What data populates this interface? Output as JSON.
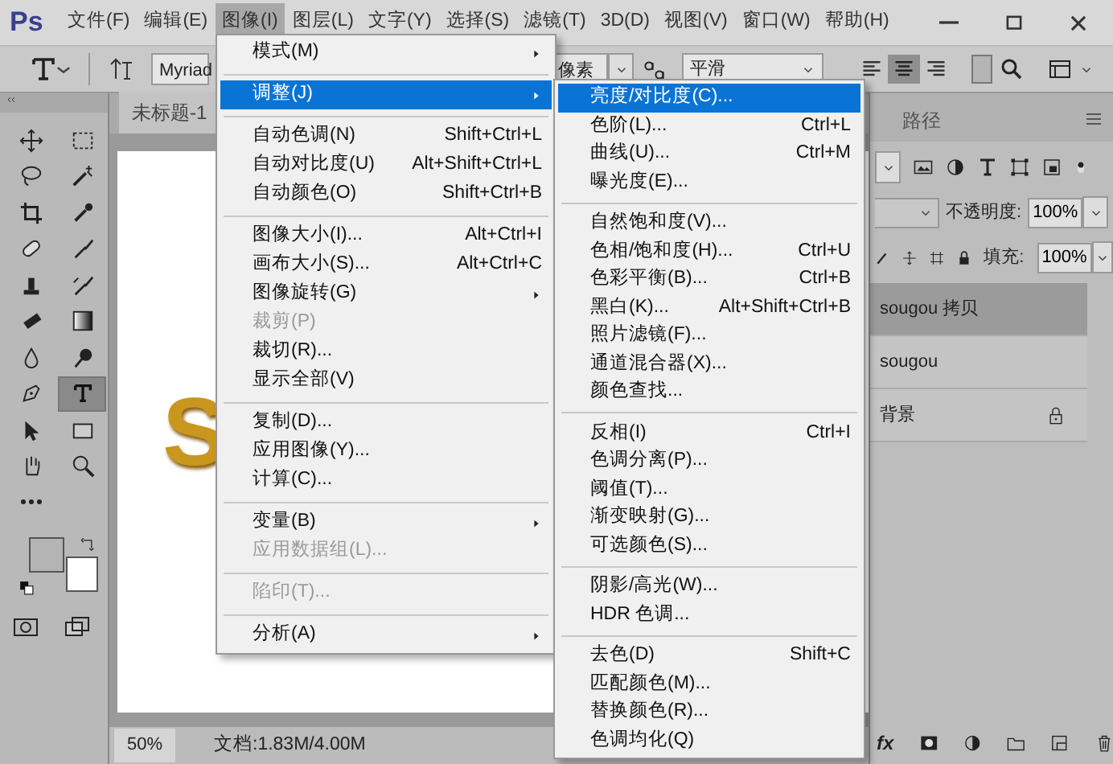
{
  "app": {
    "logo": "Ps"
  },
  "menubar": [
    {
      "label": "文件(F)",
      "selected": false
    },
    {
      "label": "编辑(E)",
      "selected": false
    },
    {
      "label": "图像(I)",
      "selected": true
    },
    {
      "label": "图层(L)",
      "selected": false
    },
    {
      "label": "文字(Y)",
      "selected": false
    },
    {
      "label": "选择(S)",
      "selected": false
    },
    {
      "label": "滤镜(T)",
      "selected": false
    },
    {
      "label": "3D(D)",
      "selected": false
    },
    {
      "label": "视图(V)",
      "selected": false
    },
    {
      "label": "窗口(W)",
      "selected": false
    },
    {
      "label": "帮助(H)",
      "selected": false
    }
  ],
  "options_bar": {
    "font": "Myriad",
    "units": "像素",
    "antialias": "平滑",
    "align": [
      {
        "selected": false
      },
      {
        "selected": true
      },
      {
        "selected": false
      }
    ]
  },
  "tools": [
    {
      "selected": false
    },
    {
      "selected": false
    },
    {
      "selected": false
    },
    {
      "selected": false
    },
    {
      "selected": false
    },
    {
      "selected": false
    },
    {
      "selected": false
    },
    {
      "selected": false
    },
    {
      "selected": false
    },
    {
      "selected": false
    },
    {
      "selected": false
    },
    {
      "selected": false
    },
    {
      "selected": false
    },
    {
      "selected": false
    },
    {
      "selected": false
    },
    {
      "selected": true
    },
    {
      "selected": false
    },
    {
      "selected": false
    },
    {
      "selected": false
    },
    {
      "selected": false
    },
    {
      "selected": false
    }
  ],
  "document": {
    "tab": "未标题-1",
    "canvas_text": "S",
    "zoom": "50%",
    "info": "文档:1.83M/4.00M"
  },
  "image_menu": [
    {
      "kind": "item",
      "label": "模式(M)",
      "has_submenu": true,
      "selected": false,
      "disabled": false
    },
    {
      "kind": "separator"
    },
    {
      "kind": "item",
      "label": "调整(J)",
      "has_submenu": true,
      "selected": true,
      "disabled": false
    },
    {
      "kind": "separator"
    },
    {
      "kind": "item",
      "label": "自动色调(N)",
      "shortcut": "Shift+Ctrl+L",
      "has_submenu": false,
      "selected": false,
      "disabled": false
    },
    {
      "kind": "item",
      "label": "自动对比度(U)",
      "shortcut": "Alt+Shift+Ctrl+L",
      "has_submenu": false,
      "selected": false,
      "disabled": false
    },
    {
      "kind": "item",
      "label": "自动颜色(O)",
      "shortcut": "Shift+Ctrl+B",
      "has_submenu": false,
      "selected": false,
      "disabled": false
    },
    {
      "kind": "separator"
    },
    {
      "kind": "item",
      "label": "图像大小(I)...",
      "shortcut": "Alt+Ctrl+I",
      "has_submenu": false,
      "selected": false,
      "disabled": false
    },
    {
      "kind": "item",
      "label": "画布大小(S)...",
      "shortcut": "Alt+Ctrl+C",
      "has_submenu": false,
      "selected": false,
      "disabled": false
    },
    {
      "kind": "item",
      "label": "图像旋转(G)",
      "has_submenu": true,
      "selected": false,
      "disabled": false
    },
    {
      "kind": "item",
      "label": "裁剪(P)",
      "has_submenu": false,
      "selected": false,
      "disabled": true
    },
    {
      "kind": "item",
      "label": "裁切(R)...",
      "has_submenu": false,
      "selected": false,
      "disabled": false
    },
    {
      "kind": "item",
      "label": "显示全部(V)",
      "has_submenu": false,
      "selected": false,
      "disabled": false
    },
    {
      "kind": "separator"
    },
    {
      "kind": "item",
      "label": "复制(D)...",
      "has_submenu": false,
      "selected": false,
      "disabled": false
    },
    {
      "kind": "item",
      "label": "应用图像(Y)...",
      "has_submenu": false,
      "selected": false,
      "disabled": false
    },
    {
      "kind": "item",
      "label": "计算(C)...",
      "has_submenu": false,
      "selected": false,
      "disabled": false
    },
    {
      "kind": "separator"
    },
    {
      "kind": "item",
      "label": "变量(B)",
      "has_submenu": true,
      "selected": false,
      "disabled": false
    },
    {
      "kind": "item",
      "label": "应用数据组(L)...",
      "has_submenu": false,
      "selected": false,
      "disabled": true
    },
    {
      "kind": "separator"
    },
    {
      "kind": "item",
      "label": "陷印(T)...",
      "has_submenu": false,
      "selected": false,
      "disabled": true
    },
    {
      "kind": "separator"
    },
    {
      "kind": "item",
      "label": "分析(A)",
      "has_submenu": true,
      "selected": false,
      "disabled": false
    }
  ],
  "adjust_submenu": [
    {
      "kind": "item",
      "label": "亮度/对比度(C)...",
      "selected": true
    },
    {
      "kind": "item",
      "label": "色阶(L)...",
      "shortcut": "Ctrl+L",
      "selected": false
    },
    {
      "kind": "item",
      "label": "曲线(U)...",
      "shortcut": "Ctrl+M",
      "selected": false
    },
    {
      "kind": "item",
      "label": "曝光度(E)...",
      "selected": false
    },
    {
      "kind": "separator"
    },
    {
      "kind": "item",
      "label": "自然饱和度(V)...",
      "selected": false
    },
    {
      "kind": "item",
      "label": "色相/饱和度(H)...",
      "shortcut": "Ctrl+U",
      "selected": false
    },
    {
      "kind": "item",
      "label": "色彩平衡(B)...",
      "shortcut": "Ctrl+B",
      "selected": false
    },
    {
      "kind": "item",
      "label": "黑白(K)...",
      "shortcut": "Alt+Shift+Ctrl+B",
      "selected": false
    },
    {
      "kind": "item",
      "label": "照片滤镜(F)...",
      "selected": false
    },
    {
      "kind": "item",
      "label": "通道混合器(X)...",
      "selected": false
    },
    {
      "kind": "item",
      "label": "颜色查找...",
      "selected": false
    },
    {
      "kind": "separator"
    },
    {
      "kind": "item",
      "label": "反相(I)",
      "shortcut": "Ctrl+I",
      "selected": false
    },
    {
      "kind": "item",
      "label": "色调分离(P)...",
      "selected": false
    },
    {
      "kind": "item",
      "label": "阈值(T)...",
      "selected": false
    },
    {
      "kind": "item",
      "label": "渐变映射(G)...",
      "selected": false
    },
    {
      "kind": "item",
      "label": "可选颜色(S)...",
      "selected": false
    },
    {
      "kind": "separator"
    },
    {
      "kind": "item",
      "label": "阴影/高光(W)...",
      "selected": false
    },
    {
      "kind": "item",
      "label": "HDR 色调...",
      "selected": false
    },
    {
      "kind": "separator"
    },
    {
      "kind": "item",
      "label": "去色(D)",
      "shortcut": "Shift+C",
      "selected": false
    },
    {
      "kind": "item",
      "label": "匹配颜色(M)...",
      "selected": false
    },
    {
      "kind": "item",
      "label": "替换颜色(R)...",
      "selected": false
    },
    {
      "kind": "item",
      "label": "色调均化(Q)",
      "selected": false
    }
  ],
  "layers_panel": {
    "tabs": [
      {
        "label": "路径",
        "selected": false
      }
    ],
    "opacity_label": "不透明度:",
    "opacity": "100%",
    "fill_label": "填充:",
    "fill": "100%",
    "layers": [
      {
        "name": "sougou 拷贝",
        "selected": true,
        "locked": false
      },
      {
        "name": "sougou",
        "selected": false,
        "locked": false
      },
      {
        "name": "背景",
        "selected": false,
        "locked": true
      }
    ],
    "fx_label": "fx"
  }
}
